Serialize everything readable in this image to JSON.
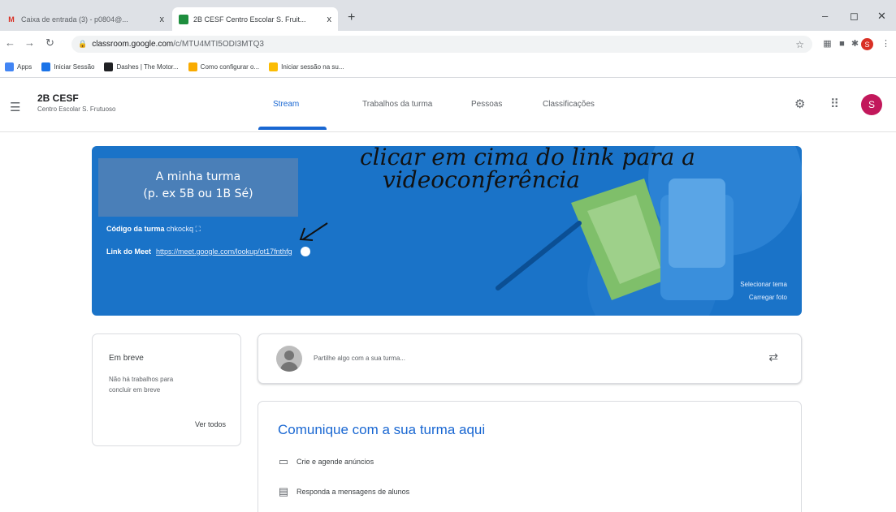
{
  "browser": {
    "tabs": [
      {
        "title": "Caixa de entrada (3) - p0804@...",
        "icon": "gmail-icon",
        "close": "x"
      },
      {
        "title": "2B CESF Centro Escolar S. Fruit...",
        "icon": "classroom-icon",
        "close": "x"
      }
    ],
    "new_tab": "+",
    "window_controls": {
      "minimize": "–",
      "maximize": "◻",
      "close": "✕"
    },
    "url_host": "classroom.google.com",
    "url_path": "/c/MTU4MTI5ODI3MTQ3",
    "bookmarks": [
      {
        "label": "Apps",
        "color": "#4285f4"
      },
      {
        "label": "Iniciar Sessão",
        "color": "#1a73e8"
      },
      {
        "label": "Dashes | The Motor...",
        "color": "#202124"
      },
      {
        "label": "Como configurar o...",
        "color": "#f9ab00"
      },
      {
        "label": "Iniciar sessão na su...",
        "color": "#fbbc04"
      }
    ],
    "profile_letter": "S"
  },
  "classroom": {
    "class_name": "2B CESF",
    "school_name": "Centro Escolar S. Frutuoso",
    "tabs": [
      "Stream",
      "Trabalhos da turma",
      "Pessoas",
      "Classificações"
    ],
    "active_tab": "Stream",
    "avatar_letter": "S"
  },
  "banner": {
    "overlay_line1": "A minha turma",
    "overlay_line2": "(p. ex 5B ou 1B Sé)",
    "code_label": "Código da turma",
    "code_value": "chkockq",
    "meet_label": "Link do Meet",
    "meet_url": "https://meet.google.com/lookup/ot17fnthfg",
    "handwritten_line1": "clicar em cima do link para a",
    "handwritten_line2": "videoconferência",
    "select_theme": "Selecionar tema",
    "upload_photo": "Carregar foto",
    "color": "#1a73c8"
  },
  "upcoming": {
    "title": "Em breve",
    "text": "Não há trabalhos para concluir em breve",
    "view_all": "Ver todos"
  },
  "share": {
    "placeholder": "Partilhe algo com a sua turma..."
  },
  "communicate": {
    "title": "Comunique com a sua turma aqui",
    "items": [
      {
        "icon": "announcement-icon",
        "label": "Crie e agende anúncios"
      },
      {
        "icon": "reply-icon",
        "label": "Responda a mensagens de alunos"
      }
    ]
  }
}
